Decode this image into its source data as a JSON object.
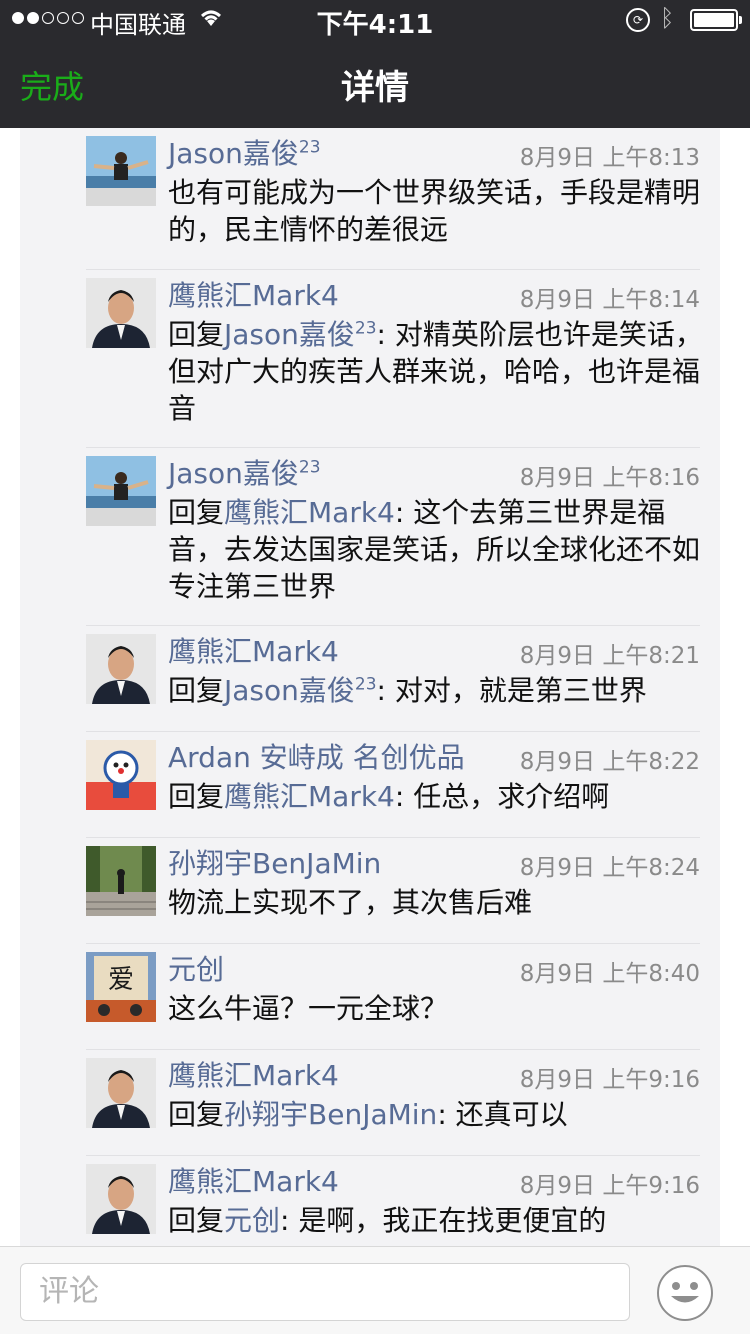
{
  "status_bar": {
    "carrier": "中国联通",
    "time": "下午4:11"
  },
  "nav": {
    "done_label": "完成",
    "title": "详情"
  },
  "comments": [
    {
      "name": "Jason嘉俊",
      "name_sup": "23",
      "time": "8月9日 上午8:13",
      "reply_prefix": "",
      "reply_to": "",
      "reply_to_sup": "",
      "text": "也有可能成为一个世界级笑话，手段是精明的，民主情怀的差很远"
    },
    {
      "name": "鹰熊汇Mark4",
      "name_sup": "",
      "time": "8月9日 上午8:14",
      "reply_prefix": "回复",
      "reply_to": "Jason嘉俊",
      "reply_to_sup": "23",
      "text": ": 对精英阶层也许是笑话，但对广大的疾苦人群来说，哈哈，也许是福音"
    },
    {
      "name": "Jason嘉俊",
      "name_sup": "23",
      "time": "8月9日 上午8:16",
      "reply_prefix": "回复",
      "reply_to": "鹰熊汇Mark4",
      "reply_to_sup": "",
      "text": ": 这个去第三世界是福音，去发达国家是笑话，所以全球化还不如专注第三世界"
    },
    {
      "name": "鹰熊汇Mark4",
      "name_sup": "",
      "time": "8月9日 上午8:21",
      "reply_prefix": "回复",
      "reply_to": "Jason嘉俊",
      "reply_to_sup": "23",
      "text": ": 对对，就是第三世界"
    },
    {
      "name": "Ardan 安峙成 名创优品",
      "name_sup": "",
      "time": "8月9日 上午8:22",
      "reply_prefix": "回复",
      "reply_to": "鹰熊汇Mark4",
      "reply_to_sup": "",
      "text": ": 任总，求介绍啊"
    },
    {
      "name": "孙翔宇BenJaMin",
      "name_sup": "",
      "time": "8月9日 上午8:24",
      "reply_prefix": "",
      "reply_to": "",
      "reply_to_sup": "",
      "text": "物流上实现不了，其次售后难"
    },
    {
      "name": "元创",
      "name_sup": "",
      "time": "8月9日 上午8:40",
      "reply_prefix": "",
      "reply_to": "",
      "reply_to_sup": "",
      "text": "这么牛逼？一元全球？"
    },
    {
      "name": "鹰熊汇Mark4",
      "name_sup": "",
      "time": "8月9日 上午9:16",
      "reply_prefix": "回复",
      "reply_to": "孙翔宇BenJaMin",
      "reply_to_sup": "",
      "text": ": 还真可以"
    },
    {
      "name": "鹰熊汇Mark4",
      "name_sup": "",
      "time": "8月9日 上午9:16",
      "reply_prefix": "回复",
      "reply_to": "元创",
      "reply_to_sup": "",
      "text": ": 是啊，我正在找更便宜的"
    }
  ],
  "input": {
    "placeholder": "评论"
  }
}
